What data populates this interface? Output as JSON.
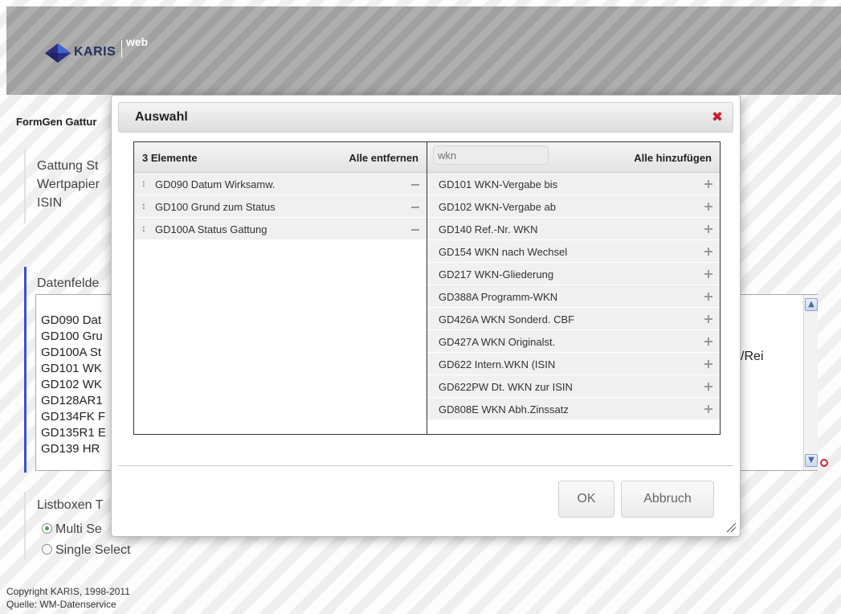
{
  "header": {
    "brand": "KARIS",
    "brand_suffix": "web",
    "logo_icon": "karis-diamond-logo-icon",
    "colors": {
      "brand_text": "#23305d",
      "logo_dark": "#2b2f7e",
      "logo_blue": "#3f63d4",
      "header_bg": "#a9a9a9"
    }
  },
  "page": {
    "title": "FormGen Gattur",
    "fields_top": [
      "Gattung St",
      "Wertpapier",
      "ISIN"
    ],
    "datenfelder_label": "Datenfelde",
    "datenfelder_items": [
      "GD090 Dat",
      "GD100 Gru",
      "GD100A St",
      "GD101 WK",
      "GD102 WK",
      "GD128AR1",
      "GD134FK F",
      "GD135R1 E",
      "GD139 HR"
    ],
    "right_fragment": "'/Rei",
    "listbox_label": "Listboxen T",
    "radio_multi": "Multi Se",
    "radio_single": "Single Select",
    "radio_selected": "multi"
  },
  "footer": {
    "copyright": "Copyright KARIS, 1998-2011",
    "source": "Quelle: WM-Datenservice"
  },
  "dialog": {
    "title": "Auswahl",
    "close_icon": "close-x-icon",
    "colors": {
      "close": "#cc1a33"
    },
    "selected": {
      "count_label": "3 Elemente",
      "remove_all_label": "Alle entfernen",
      "items": [
        {
          "label": "GD090 Datum Wirksamw."
        },
        {
          "label": "GD100 Grund zum Status"
        },
        {
          "label": "GD100A Status Gattung"
        }
      ]
    },
    "available": {
      "search_value": "",
      "search_placeholder": "wkn",
      "add_all_label": "Alle hinzufügen",
      "items": [
        {
          "label": "GD101 WKN-Vergabe bis"
        },
        {
          "label": "GD102 WKN-Vergabe ab"
        },
        {
          "label": "GD140 Ref.-Nr. WKN"
        },
        {
          "label": "GD154 WKN nach Wechsel"
        },
        {
          "label": "GD217 WKN-Gliederung"
        },
        {
          "label": "GD388A Programm-WKN"
        },
        {
          "label": "GD426A WKN Sonderd. CBF"
        },
        {
          "label": "GD427A WKN Originalst."
        },
        {
          "label": "GD622 Intern.WKN (ISIN"
        },
        {
          "label": "GD622PW Dt. WKN zur ISIN"
        },
        {
          "label": "GD808E WKN Abh.Zinssatz"
        }
      ]
    },
    "ok_label": "OK",
    "cancel_label": "Abbruch"
  }
}
